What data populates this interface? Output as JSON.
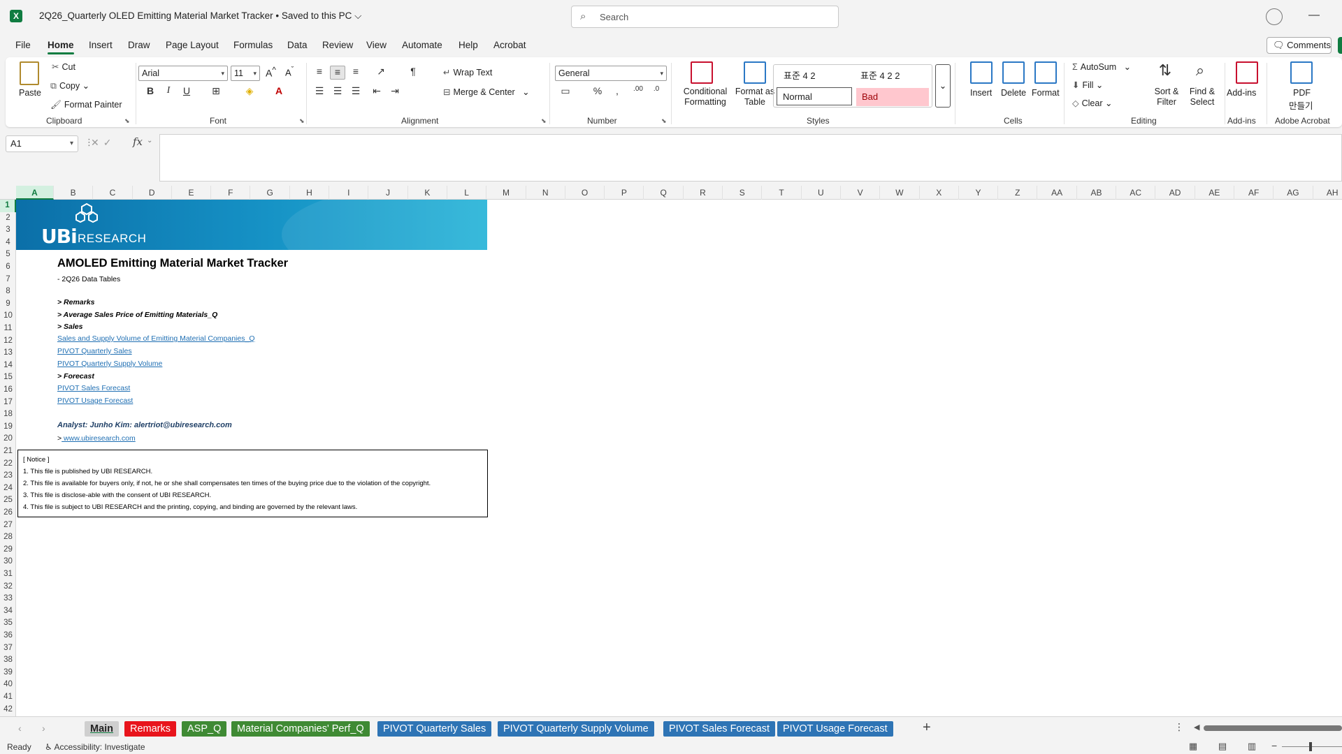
{
  "titlebar": {
    "app_icon": "excel-icon",
    "doc_title": "2Q26_Quarterly OLED Emitting Material Market Tracker • Saved to this PC ⌵",
    "search_placeholder": "Search"
  },
  "menu": {
    "tabs": [
      "File",
      "Home",
      "Insert",
      "Draw",
      "Page Layout",
      "Formulas",
      "Data",
      "Review",
      "View",
      "Automate",
      "Help",
      "Acrobat"
    ],
    "active": "Home",
    "comments": "Comments"
  },
  "ribbon": {
    "clipboard": {
      "paste": "Paste",
      "cut": "Cut",
      "copy": "Copy",
      "format_painter": "Format Painter",
      "label": "Clipboard"
    },
    "font": {
      "family": "Arial",
      "size": "11",
      "bold": "B",
      "italic": "I",
      "underline": "U",
      "label": "Font"
    },
    "alignment": {
      "wrap_text": "Wrap Text",
      "merge_center": "Merge & Center",
      "label": "Alignment"
    },
    "number": {
      "format": "General",
      "label": "Number"
    },
    "styles": {
      "conditional": "Conditional Formatting",
      "format_table": "Format as Table",
      "style1": "표준 4 2",
      "style2": "표준 4 2 2",
      "normal": "Normal",
      "bad": "Bad",
      "label": "Styles"
    },
    "cells": {
      "insert": "Insert",
      "delete": "Delete",
      "format": "Format",
      "label": "Cells"
    },
    "editing": {
      "autosum": "AutoSum",
      "fill": "Fill",
      "clear": "Clear",
      "sort_filter": "Sort & Filter",
      "find_select": "Find & Select",
      "label": "Editing"
    },
    "addins": {
      "addins": "Add-ins",
      "label": "Add-ins"
    },
    "acrobat": {
      "pdf": "PDF",
      "make": "만들기",
      "label": "Adobe Acrobat"
    }
  },
  "formula_bar": {
    "cell_ref": "A1",
    "fx": "fx",
    "value": ""
  },
  "grid": {
    "columns": [
      "A",
      "B",
      "C",
      "D",
      "E",
      "F",
      "G",
      "H",
      "I",
      "J",
      "K",
      "L",
      "M",
      "N",
      "O",
      "P",
      "Q",
      "R",
      "S",
      "T",
      "U",
      "V",
      "W",
      "X",
      "Y",
      "Z",
      "AA",
      "AB",
      "AC",
      "AD",
      "AE",
      "AF",
      "AG",
      "AH"
    ],
    "rows": [
      "1",
      "2",
      "3",
      "4",
      "5",
      "6",
      "7",
      "8",
      "9",
      "10",
      "11",
      "12",
      "13",
      "14",
      "15",
      "16",
      "17",
      "18",
      "19",
      "20",
      "21",
      "22",
      "23",
      "24",
      "25",
      "26",
      "27",
      "28",
      "29",
      "30",
      "31",
      "32",
      "33",
      "34",
      "35",
      "36",
      "37",
      "38",
      "39",
      "40",
      "41",
      "42"
    ],
    "selected_cell": "A1"
  },
  "content": {
    "logo_ubi": "UBi",
    "logo_research": "RESEARCH",
    "title": "AMOLED Emitting Material Market Tracker",
    "subtitle": "- 2Q26 Data Tables",
    "remarks": "> Remarks",
    "asp": "> Average Sales Price of Emitting Materials_Q",
    "sales": "> Sales",
    "link_sales_supply": "Sales and Supply Volume of Emitting Material Companies_Q",
    "link_pivot_sales": "PIVOT Quarterly Sales",
    "link_pivot_supply": "PIVOT Quarterly Supply Volume",
    "forecast": "> Forecast",
    "link_sales_forecast": "PIVOT Sales Forecast",
    "link_usage_forecast": "PIVOT Usage Forecast",
    "analyst": "Analyst: Junho Kim: alertriot@ubiresearch.com",
    "website_prefix": ">",
    "website": " www.ubiresearch.com",
    "notice": [
      "[ Notice ]",
      "1. This file is published by UBI RESEARCH.",
      "2. This file is available for buyers only, if not, he or she shall compensates ten times of the buying price due to the violation of the copyright.",
      "3. This file is disclose-able with the consent of UBI RESEARCH.",
      "4. This file is subject to UBI RESEARCH and the printing, copying, and binding are governed by the relevant laws."
    ]
  },
  "sheets": [
    {
      "name": "Main",
      "color": "#cfcfcf"
    },
    {
      "name": "Remarks",
      "color": "#e8141c"
    },
    {
      "name": "ASP_Q",
      "color": "#3f8a34"
    },
    {
      "name": "Material Companies' Perf_Q",
      "color": "#3f8a34"
    },
    {
      "name": "PIVOT Quarterly Sales",
      "color": "#2e74b5"
    },
    {
      "name": "PIVOT Quarterly Supply Volume",
      "color": "#2e74b5"
    },
    {
      "name": "PIVOT Sales Forecast",
      "color": "#2e74b5"
    },
    {
      "name": "PIVOT Usage Forecast",
      "color": "#2e74b5"
    }
  ],
  "status": {
    "ready": "Ready",
    "accessibility": "Accessibility: Investigate"
  }
}
